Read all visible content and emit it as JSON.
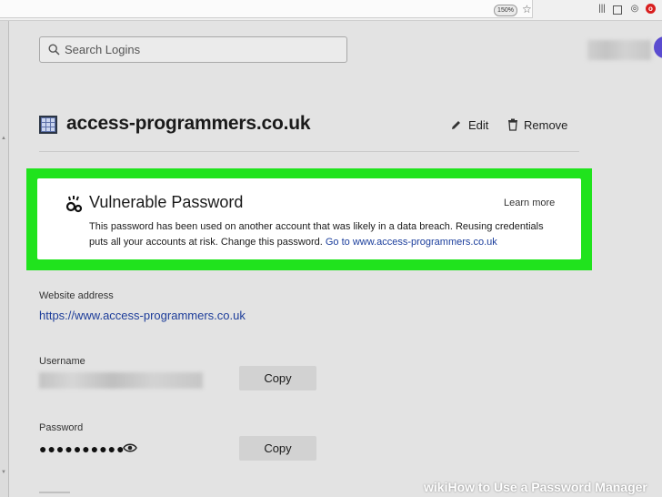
{
  "browser": {
    "zoom_level": "150%"
  },
  "search": {
    "placeholder": "Search Logins"
  },
  "login": {
    "site_title": "access-programmers.co.uk",
    "edit_label": "Edit",
    "remove_label": "Remove",
    "website_label": "Website address",
    "website_url": "https://www.access-programmers.co.uk",
    "username_label": "Username",
    "password_label": "Password",
    "password_masked": "●●●●●●●●●●",
    "copy_label": "Copy"
  },
  "alert": {
    "title": "Vulnerable Password",
    "learn_more": "Learn more",
    "body": "This password has been used on another account that was likely in a data breach. Reusing credentials puts all your accounts at risk. Change this password.",
    "link_text": "Go to www.access-programmers.co.uk",
    "highlight_color": "#20e31d"
  },
  "watermark": {
    "wiki": "wiki",
    "text": "How to Use a Password Manager"
  },
  "colors": {
    "page_bg": "#e3e3e3",
    "link": "#1d3d9a"
  }
}
